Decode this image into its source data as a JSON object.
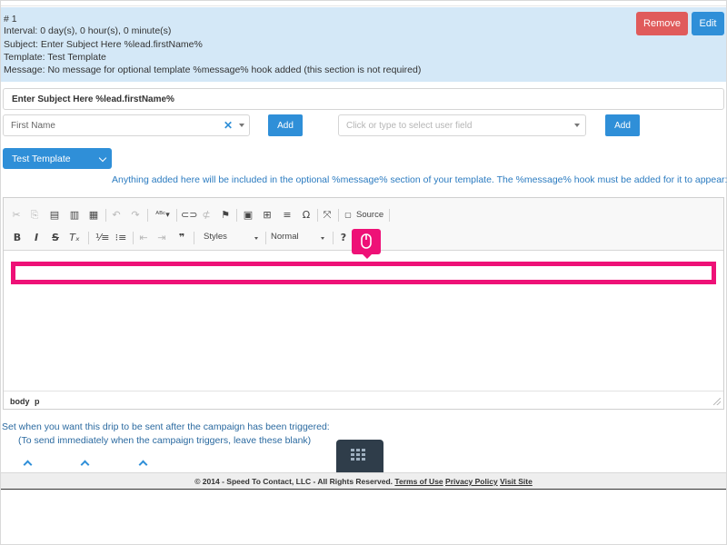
{
  "drip": {
    "number": "# 1",
    "interval": "Interval: 0 day(s), 0 hour(s), 0 minute(s)",
    "subject": "Subject: Enter Subject Here %lead.firstName%",
    "template": "Template: Test Template",
    "message": "Message: No message for optional template %message% hook added (this section is not required)",
    "remove_label": "Remove",
    "edit_label": "Edit",
    "accent_color": "#2f8fd8",
    "remove_color": "#e05b5b",
    "panel_color": "#d4e8f7"
  },
  "form": {
    "subject_value": "Enter Subject Here %lead.firstName%",
    "field_select_value": "First Name",
    "add_label": "Add",
    "user_field_placeholder": "Click or type to select user field",
    "template_select_value": "Test Template",
    "hint": "Anything added here will be included in the optional %message% section of your template. The %message% hook must be added for it to appear:"
  },
  "editor": {
    "toolbar_row1": [
      "cut-icon",
      "copy-icon",
      "paste-icon",
      "paste-text-icon",
      "paste-word-icon",
      "undo-icon",
      "redo-icon",
      "spellcheck-icon",
      "link-icon",
      "unlink-icon",
      "anchor-icon",
      "image-icon",
      "table-icon",
      "horizontal-line-icon",
      "special-char-icon",
      "maximize-icon",
      "source-icon"
    ],
    "source_label": "Source",
    "styles_label": "Styles",
    "format_label": "Normal",
    "path": [
      "body",
      "p"
    ],
    "highlight_color": "#ee1177"
  },
  "schedule": {
    "line1": "Set when you want this drip to be sent after the campaign has been triggered:",
    "line2": "(To send immediately when the campaign triggers, leave these blank)"
  },
  "footer": {
    "copyright": "© 2014 - Speed To Contact, LLC - All Rights Reserved.",
    "terms": "Terms of Use",
    "privacy": "Privacy Policy",
    "visit": "Visit Site"
  }
}
